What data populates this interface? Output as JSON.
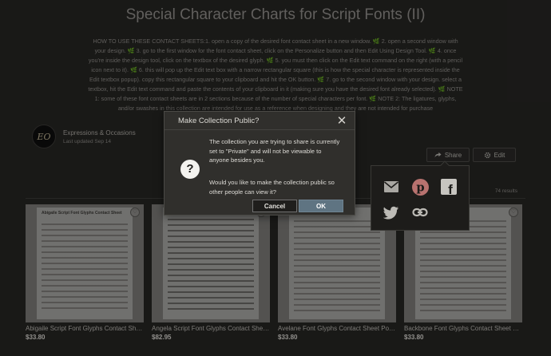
{
  "page": {
    "title": "Special Character Charts for Script Fonts (II)",
    "description": "HOW TO USE THESE CONTACT SHEETS:1. open a copy of the desired font contact sheet in a new window. 🌿 2. open a second window with your design. 🌿 3. go to the first window for the font contact sheet, click on the Personalize button and then Edit Using Design Tool. 🌿 4. once you're inside the design tool, click on the textbox of the desired glyph. 🌿 5. you must then click on the Edit text command on the right (with a pencil icon next to it). 🌿 6. this will pop up the Edit text box with a narrow rectangular square (this is how the special character is represented inside the Edit textbox popup). copy this rectangular square to your clipboard and hit the OK button. 🌿 7. go to the second window with your design. select a textbox, hit the Edit text command and paste the contents of your clipboard in it (making sure you have the desired font already selected). 🌿 NOTE 1: some of these font contact sheets are in 2 sections because of the number of special characters per font. 🌿 NOTE 2: The ligatures, glyphs, and/or swashes in this collection are intended for use as a reference when designing and they are not intended for purchase"
  },
  "profile": {
    "monogram": "EO",
    "name": "Expressions & Occasions",
    "updated": "Last updated Sep 14"
  },
  "actions": {
    "share_label": "Share",
    "edit_label": "Edit"
  },
  "results": {
    "count": "74 results"
  },
  "products": [
    {
      "sheet_title": "Abigaile Script Font Glyphs Contact Sheet",
      "name": "Abigaile Script Font Glyphs Contact Shee...",
      "price": "$33.80"
    },
    {
      "sheet_title": "",
      "name": "Angela Script Font Glyphs Contact Sheet ...",
      "price": "$82.95"
    },
    {
      "sheet_title": "",
      "name": "Avelane Font Glyphs Contact Sheet Poster",
      "price": "$33.80"
    },
    {
      "sheet_title": "",
      "name": "Backbone Font Glyphs Contact Sheet Pos...",
      "price": "$33.80"
    }
  ],
  "modal": {
    "title": "Make Collection Public?",
    "close_glyph": "✕",
    "help_glyph": "?",
    "message_1": "The collection you are trying to share is currently set to \"Private\" and will not be viewable to anyone besides you.",
    "message_2": "Would you like to make the collection public so other people can view it?",
    "cancel_label": "Cancel",
    "ok_label": "OK"
  },
  "share_menu": {
    "colors": {
      "email": "#a9a7a2",
      "pinterest": "#b8726f",
      "facebook": "#c7c5c0",
      "twitter": "#bdbbb6",
      "link": "#bdbbb6"
    }
  }
}
